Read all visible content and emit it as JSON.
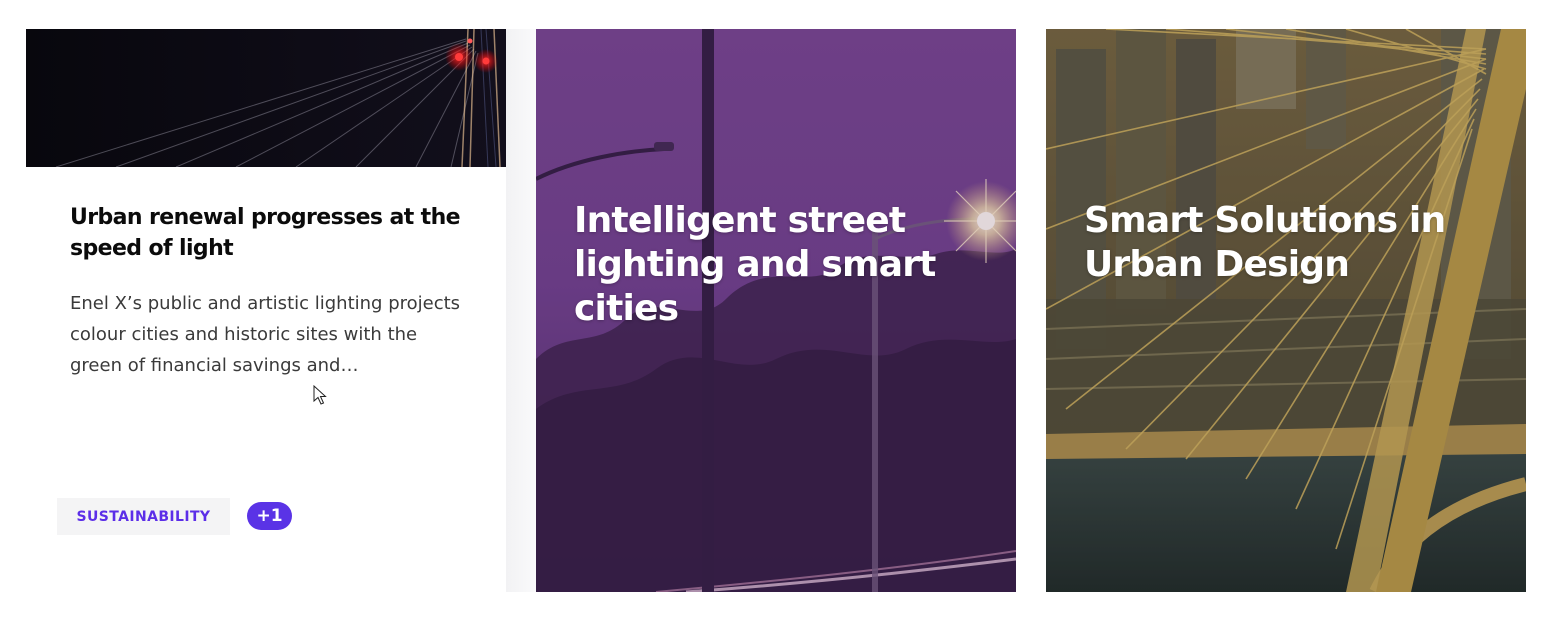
{
  "cards": [
    {
      "title": "Urban renewal progresses at the speed of light",
      "excerpt": "Enel X’s public and artistic lighting projects colour cities and historic sites with the green of financial savings and…",
      "tag": "SUSTAINABILITY",
      "more_tags": "+1",
      "image": "night-highway-light-trails"
    },
    {
      "title": "Intelligent street lighting and smart cities",
      "image": "purple-street-lamp-sunset"
    },
    {
      "title": "Smart Solutions in Urban Design",
      "image": "cable-stayed-bridge-city"
    }
  ],
  "colors": {
    "accent": "#5c2ee8",
    "tag_bg": "#f4f4f5",
    "title": "#0b0b0b",
    "text": "#3a3a3a",
    "purple_overlay": "#6a3d8a",
    "gold_overlay": "#c9a24a"
  },
  "icons": [
    "mouse-pointer-icon"
  ]
}
